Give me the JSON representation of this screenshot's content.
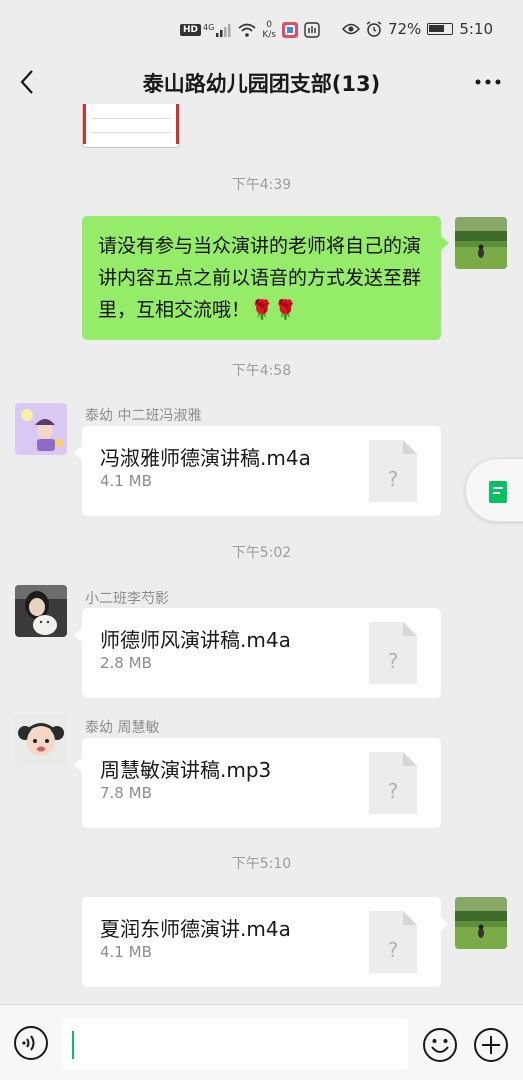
{
  "status_bar": {
    "network_badge": "HD",
    "network_type": "4G",
    "speed_value": "0",
    "speed_unit": "K/s",
    "battery": "72%",
    "time": "5:10"
  },
  "header": {
    "title": "泰山路幼儿园团支部(13)"
  },
  "messages": [
    {
      "type": "time",
      "text": "下午4:39"
    },
    {
      "type": "text",
      "side": "right",
      "text": "请没有参与当众演讲的老师将自己的演讲内容五点之前以语音的方式发送至群里，互相交流哦！🌹🌹"
    },
    {
      "type": "time",
      "text": "下午4:58"
    },
    {
      "type": "file",
      "side": "left",
      "sender": "泰幼 中二班冯淑雅",
      "file_name": "冯淑雅师德演讲稿.m4a",
      "file_size": "4.1 MB"
    },
    {
      "type": "time",
      "text": "下午5:02"
    },
    {
      "type": "file",
      "side": "left",
      "sender": "小二班李芍影",
      "file_name": "师德师风演讲稿.m4a",
      "file_size": "2.8 MB"
    },
    {
      "type": "file",
      "side": "left",
      "sender": "泰幼 周慧敏",
      "file_name": "周慧敏演讲稿.mp3",
      "file_size": "7.8 MB"
    },
    {
      "type": "time",
      "text": "下午5:10"
    },
    {
      "type": "file",
      "side": "right",
      "file_name": "夏润东师德演讲.m4a",
      "file_size": "4.1 MB"
    }
  ],
  "file_icon_glyph": "?",
  "colors": {
    "background": "#ededed",
    "my_bubble": "#95ec69",
    "accent": "#07c160"
  },
  "input": {
    "value": "",
    "placeholder": ""
  }
}
